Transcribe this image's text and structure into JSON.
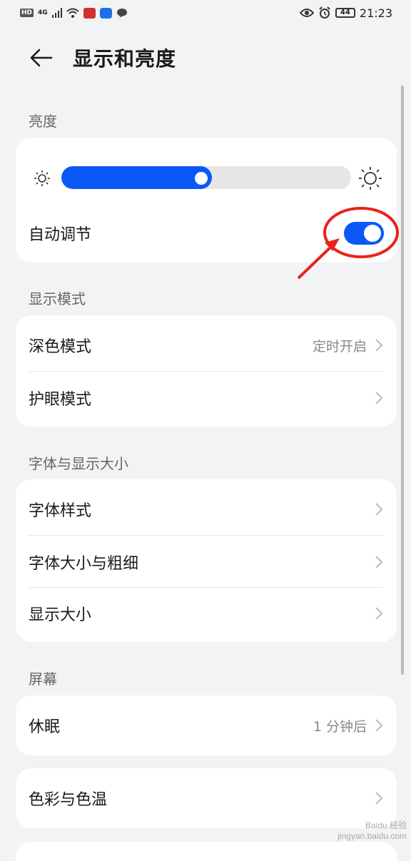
{
  "status_bar": {
    "hd": "HD",
    "signal": "4G",
    "battery": "44",
    "time": "21:23"
  },
  "header": {
    "title": "显示和亮度"
  },
  "sections": {
    "brightness": "亮度",
    "display_mode": "显示模式",
    "font_display_size": "字体与显示大小",
    "screen": "屏幕"
  },
  "brightness": {
    "level": 0.52,
    "auto_label": "自动调节",
    "auto_on": true
  },
  "display_mode": {
    "dark_mode_label": "深色模式",
    "dark_mode_value": "定时开启",
    "eye_comfort_label": "护眼模式"
  },
  "font": {
    "style_label": "字体样式",
    "size_weight_label": "字体大小与粗细",
    "display_size_label": "显示大小"
  },
  "screen": {
    "sleep_label": "休眠",
    "sleep_value": "1 分钟后",
    "color_temp_label": "色彩与色温"
  },
  "watermark": "Baidu 经验 jingyan.baidu.com",
  "colors": {
    "accent": "#0a59f7",
    "annotation": "#e8231b"
  }
}
